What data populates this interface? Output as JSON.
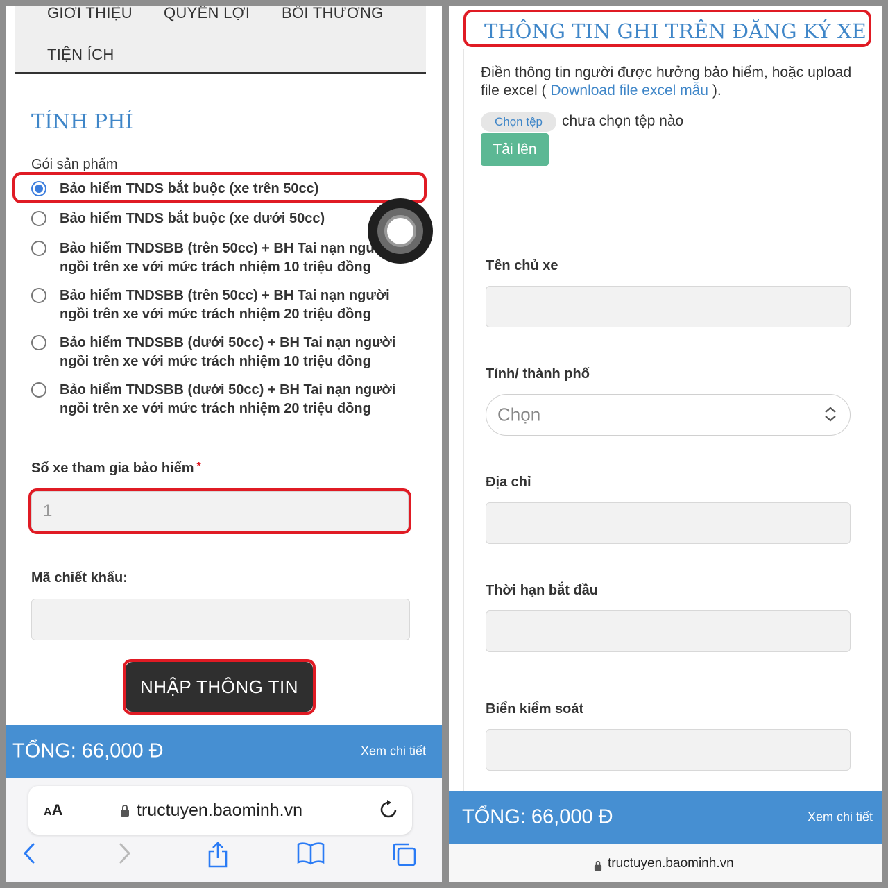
{
  "left": {
    "nav": {
      "gioi_thieu": "GIỚI THIỆU",
      "quyen_loi": "QUYỀN LỢI",
      "boi_thuong": "BỒI THƯỜNG",
      "tien_ich": "TIỆN ÍCH"
    },
    "section_title": "TÍNH PHÍ",
    "goi_san_pham_label": "Gói sản phẩm",
    "options": [
      {
        "label": "Bảo hiểm TNDS bắt buộc (xe trên 50cc)",
        "selected": true
      },
      {
        "label": "Bảo hiểm TNDS bắt buộc (xe dưới 50cc)",
        "selected": false
      },
      {
        "label": "Bảo hiểm TNDSBB (trên 50cc) + BH Tai nạn người ngồi trên xe với mức trách nhiệm 10 triệu đồng",
        "selected": false
      },
      {
        "label": "Bảo hiểm TNDSBB (trên 50cc) + BH Tai nạn người ngồi trên xe với mức trách nhiệm 20 triệu đồng",
        "selected": false
      },
      {
        "label": "Bảo hiểm TNDSBB (dưới 50cc) + BH Tai nạn người ngồi trên xe với mức trách nhiệm 10 triệu đồng",
        "selected": false
      },
      {
        "label": "Bảo hiểm TNDSBB (dưới 50cc) + BH Tai nạn người ngồi trên xe với mức trách nhiệm 20 triệu đồng",
        "selected": false
      }
    ],
    "so_xe_label": "Số xe tham gia bảo hiểm",
    "required_mark": "*",
    "so_xe_value": "1",
    "ma_chiet_khau_label": "Mã chiết khấu:",
    "ma_chiet_khau_value": "",
    "submit_label": "NHẬP THÔNG TIN",
    "total": "TỔNG: 66,000 Đ",
    "detail_link": "Xem chi tiết",
    "browser": {
      "aa_big": "A",
      "aa_small": "A",
      "url": "tructuyen.baominh.vn"
    },
    "icons": [
      "back-icon",
      "forward-icon",
      "share-icon",
      "bookmarks-icon",
      "tabs-icon",
      "reload-icon",
      "lock-icon"
    ]
  },
  "right": {
    "title": "THÔNG TIN GHI TRÊN ĐĂNG KÝ XE",
    "desc_prefix": "Điền thông tin người được hưởng bảo hiểm, hoặc upload file excel ( ",
    "desc_link": "Download file excel mẫu",
    "desc_suffix": " ).",
    "file_button": "Chọn tệp",
    "file_status": "chưa chọn tệp nào",
    "upload_button": "Tải lên",
    "ten_chu_xe_label": "Tên chủ xe",
    "ten_chu_xe_value": "",
    "tinh_label": "Tỉnh/ thành phố",
    "tinh_value": "Chọn",
    "dia_chi_label": "Địa chỉ",
    "dia_chi_value": "",
    "thoi_han_label": "Thời hạn bắt đầu",
    "thoi_han_value": "",
    "bien_label": "Biển kiểm soát",
    "bien_value": "",
    "total": "TỔNG: 66,000 Đ",
    "detail_link": "Xem chi tiết",
    "url": "tructuyen.baominh.vn"
  },
  "colors": {
    "accent_blue": "#468fd2",
    "title_blue": "#3f86c8",
    "highlight_red": "#e01b24",
    "upload_green": "#5cb894",
    "submit_dark": "#2f2f2f"
  }
}
